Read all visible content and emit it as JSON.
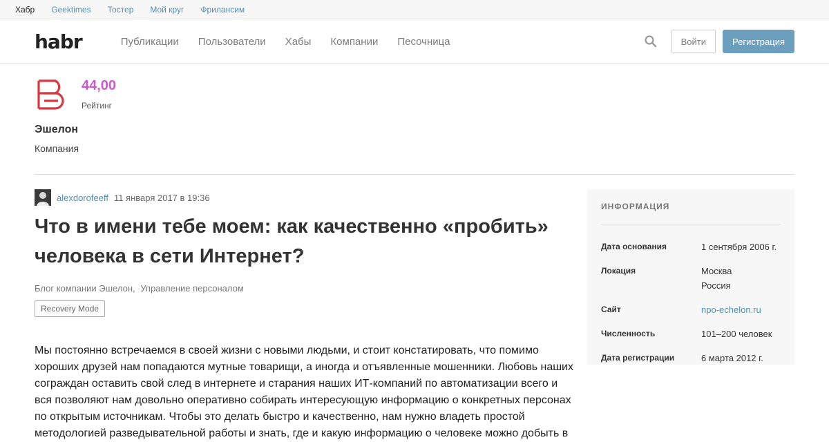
{
  "topbar": {
    "links": [
      "Хабр",
      "Geektimes",
      "Тостер",
      "Мой круг",
      "Фрилансим"
    ]
  },
  "header": {
    "logo": "habr",
    "nav": [
      "Публикации",
      "Пользователи",
      "Хабы",
      "Компании",
      "Песочница"
    ],
    "login": "Войти",
    "register": "Регистрация"
  },
  "company": {
    "rating_value": "44,00",
    "rating_label": "Рейтинг",
    "name": "Эшелон",
    "type": "Компания"
  },
  "article": {
    "author": "alexdorofeeff",
    "date": "11 января 2017 в 19:36",
    "title": "Что в имени тебе моем: как качественно «пробить» человека в сети Интернет?",
    "hubs": [
      "Блог компании Эшелон,",
      "Управление персоналом"
    ],
    "tag": "Recovery Mode",
    "body": "Мы постоянно встречаемся в своей жизни с новыми людьми, и стоит констатировать, что помимо хороших друзей нам попадаются мутные товарищи, а иногда и отъявленные мошенники. Любовь наших сограждан оставить свой след в интернете и старания наших ИТ-компаний по автоматизации всего и вся позволяют нам довольно оперативно собирать интересующую информацию о конкретных персонах по открытым источникам. Чтобы это делать быстро и качественно, нам нужно владеть простой методологией разведывательной работы и знать, где и какую информацию о человеке можно добыть в"
  },
  "sidebar": {
    "title": "ИНФОРМАЦИЯ",
    "rows": [
      {
        "key": "Дата основания",
        "value": "1 сентября 2006 г."
      },
      {
        "key": "Локация",
        "value": "Москва\nРоссия"
      },
      {
        "key": "Сайт",
        "value": "npo-echelon.ru"
      },
      {
        "key": "Численность",
        "value": "101–200 человек"
      },
      {
        "key": "Дата регистрации",
        "value": "6 марта 2012 г."
      }
    ]
  },
  "colors": {
    "accent_link": "#548eaa",
    "rating": "#c95bc9",
    "register_button": "#6c9fbe",
    "logo_red": "#d9363e"
  }
}
